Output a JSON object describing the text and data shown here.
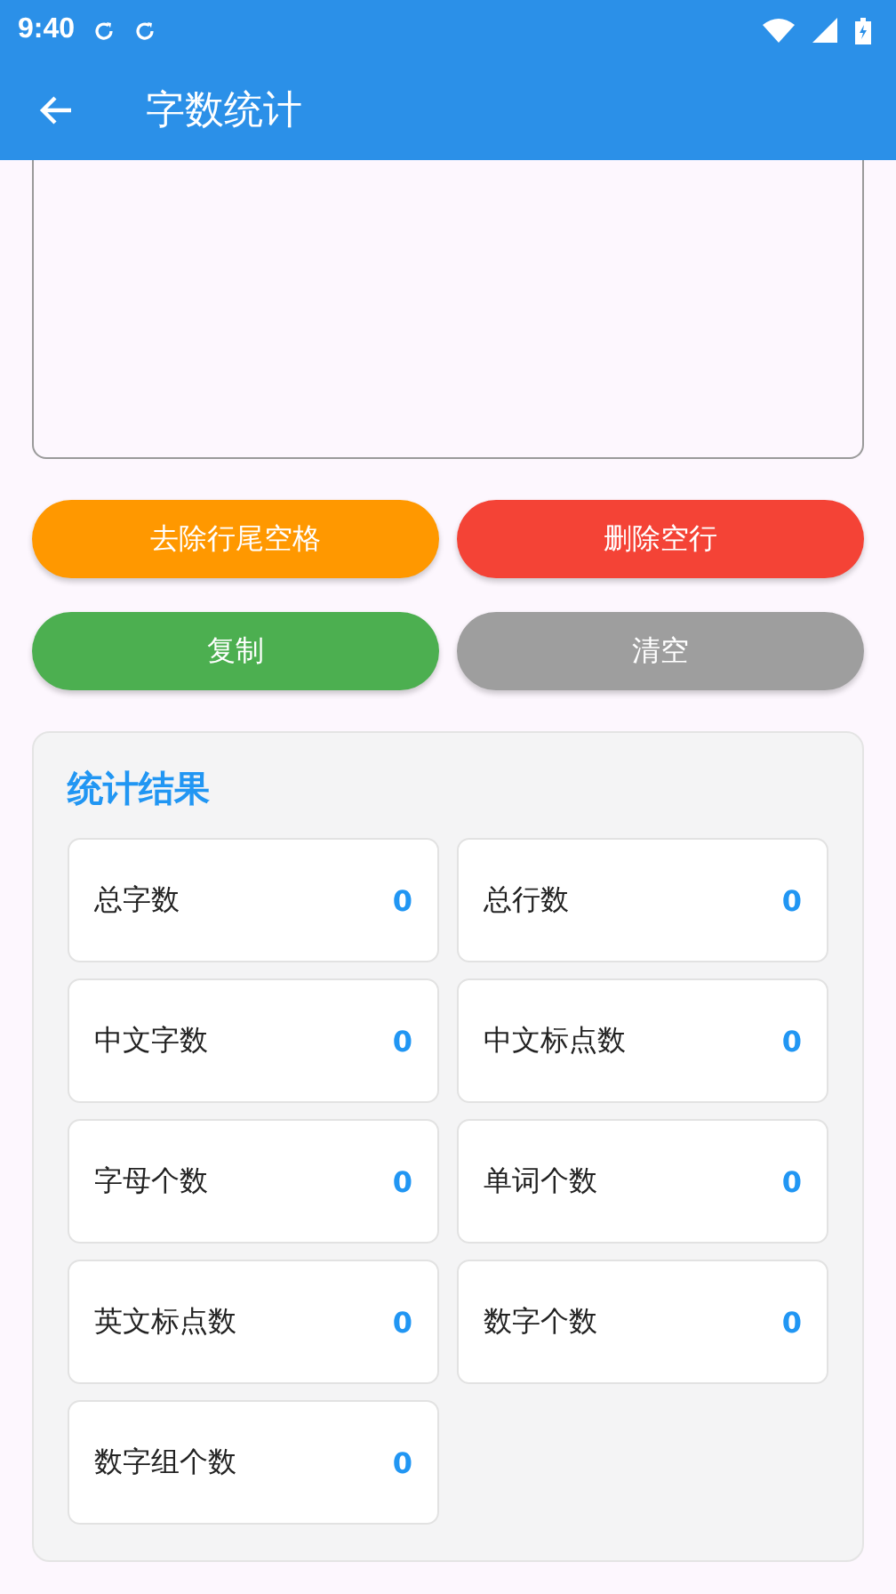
{
  "status_bar": {
    "time": "9:40"
  },
  "app_bar": {
    "title": "字数统计"
  },
  "buttons": [
    {
      "label": "去除行尾空格",
      "color": "#ff9800"
    },
    {
      "label": "删除空行",
      "color": "#f44336"
    },
    {
      "label": "复制",
      "color": "#4caf50"
    },
    {
      "label": "清空",
      "color": "#9e9e9e"
    }
  ],
  "results": {
    "title": "统计结果",
    "items": [
      {
        "label": "总字数",
        "value": "0"
      },
      {
        "label": "总行数",
        "value": "0"
      },
      {
        "label": "中文字数",
        "value": "0"
      },
      {
        "label": "中文标点数",
        "value": "0"
      },
      {
        "label": "字母个数",
        "value": "0"
      },
      {
        "label": "单词个数",
        "value": "0"
      },
      {
        "label": "英文标点数",
        "value": "0"
      },
      {
        "label": "数字个数",
        "value": "0"
      },
      {
        "label": "数字组个数",
        "value": "0"
      }
    ]
  }
}
